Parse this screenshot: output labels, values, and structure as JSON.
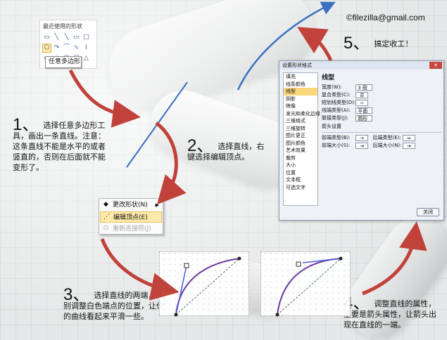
{
  "email": "©filezilla@gmail.com",
  "palette": {
    "title": "最近使用的形状",
    "tooltip": "任意多边形",
    "shapes_row1": [
      "▭",
      "╲",
      "╲",
      "▭",
      "□"
    ],
    "shapes_row2": [
      "⬠",
      "↷",
      "⌒",
      "∿",
      "⌇"
    ],
    "shapes_row3": [
      "▭",
      "△",
      "◯",
      "☐",
      "△"
    ]
  },
  "steps": [
    {
      "num": "1、",
      "text": "选择任意多边形工具，画出一条直线。注意：这条直线不能是水平的或者竖直的，否则在后面就不能变形了。"
    },
    {
      "num": "2、",
      "text": "选择直线，右键选择编辑顶点。"
    },
    {
      "num": "3、",
      "text": "选择直线的两端，分别调整白色端点的位置，让你的曲线看起来平滑一些。"
    },
    {
      "num": "4、",
      "text": "调整直线的属性，主要是箭头属性，让箭头出现在直线的一端。"
    },
    {
      "num": "5、",
      "text": "搞定收工！"
    }
  ],
  "context_menu": {
    "items": [
      {
        "label": "更改形状(N)",
        "icon": "change-shape-icon",
        "state": "normal",
        "has_submenu": true
      },
      {
        "label": "编辑顶点(E)",
        "icon": "edit-points-icon",
        "state": "highlighted"
      },
      {
        "label": "重新连接符(J)",
        "icon": "reroute-icon",
        "state": "disabled"
      }
    ]
  },
  "dialog": {
    "title": "设置形状格式",
    "nav_items": [
      "填充",
      "线条颜色",
      "线型",
      "阴影",
      "映像",
      "发光和柔化边缘",
      "三维格式",
      "三维旋转",
      "图片更正",
      "图片颜色",
      "艺术效果",
      "裁剪",
      "大小",
      "位置",
      "文本框",
      "可选文字"
    ],
    "active_nav": "线型",
    "panel_heading": "线型",
    "width_label": "宽度(W):",
    "width_value": "3 磅",
    "compound_label": "复合类型(C):",
    "dash_label": "短划线类型(D):",
    "cap_label": "线端类型(A):",
    "cap_value": "平面",
    "join_label": "联接类型(J):",
    "join_value": "圆形",
    "arrow_settings": "箭头设置",
    "begin_type": "前端类型(B):",
    "end_type": "后端类型(E):",
    "begin_size": "前端大小(S):",
    "end_size": "后端大小(N):",
    "close_button": "关闭"
  }
}
